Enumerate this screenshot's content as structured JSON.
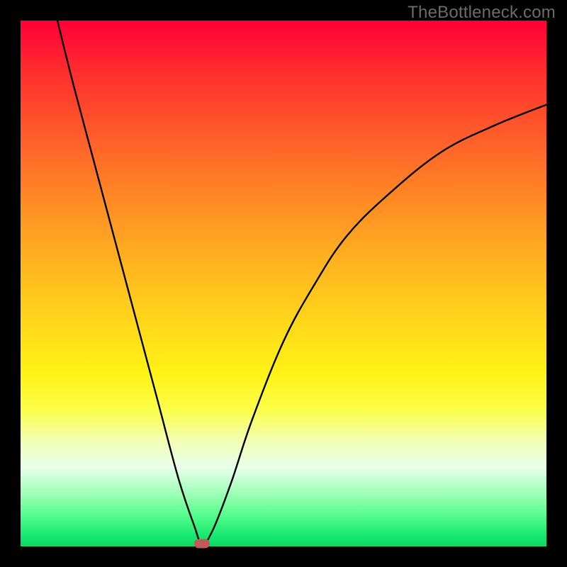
{
  "watermark": "TheBottleneck.com",
  "chart_data": {
    "type": "line",
    "title": "",
    "xlabel": "",
    "ylabel": "",
    "xlim": [
      0,
      100
    ],
    "ylim": [
      0,
      100
    ],
    "grid": false,
    "legend": false,
    "background_gradient": {
      "top": "#ff0035",
      "bottom": "#0fd663",
      "stops": [
        "red",
        "orange",
        "yellow",
        "green"
      ]
    },
    "series": [
      {
        "name": "bottleneck-curve",
        "color": "#000000",
        "x": [
          7,
          10,
          14,
          18,
          22,
          26,
          30,
          33,
          34.5,
          36.5,
          40,
          44,
          50,
          56,
          62,
          70,
          80,
          90,
          100
        ],
        "y": [
          100,
          88,
          73,
          58,
          43,
          28,
          13,
          4,
          0.5,
          3,
          12,
          24,
          39,
          50,
          59,
          67,
          75,
          80,
          84
        ]
      }
    ],
    "marker": {
      "name": "minimum-point",
      "x": 34.5,
      "y": 0.5,
      "color": "#c15a5a",
      "shape": "pill"
    }
  }
}
